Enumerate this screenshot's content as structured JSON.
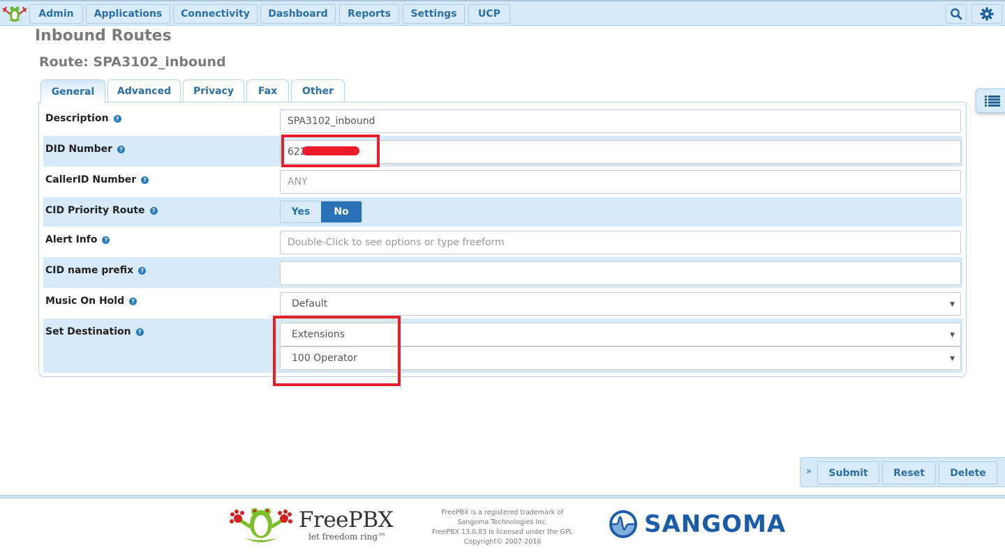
{
  "nav": {
    "items": [
      "Admin",
      "Applications",
      "Connectivity",
      "Dashboard",
      "Reports",
      "Settings",
      "UCP"
    ],
    "search_icon": "search-icon",
    "settings_icon": "gear-icon"
  },
  "page": {
    "title": "Inbound Routes",
    "route_title": "Route: SPA3102_inbound"
  },
  "tabs": [
    {
      "label": "General",
      "active": true
    },
    {
      "label": "Advanced",
      "active": false
    },
    {
      "label": "Privacy",
      "active": false
    },
    {
      "label": "Fax",
      "active": false
    },
    {
      "label": "Other",
      "active": false
    }
  ],
  "form": {
    "description": {
      "label": "Description",
      "value": "SPA3102_inbound"
    },
    "did_number": {
      "label": "DID Number",
      "value": "622",
      "redacted": true
    },
    "callerid_number": {
      "label": "CallerID Number",
      "placeholder": "ANY"
    },
    "cid_priority_route": {
      "label": "CID Priority Route",
      "options": [
        "Yes",
        "No"
      ],
      "selected": "No"
    },
    "alert_info": {
      "label": "Alert Info",
      "placeholder": "Double-Click to see options or type freeform"
    },
    "cid_name_prefix": {
      "label": "CID name prefix",
      "value": ""
    },
    "music_on_hold": {
      "label": "Music On Hold",
      "value": "Default"
    },
    "set_destination": {
      "label": "Set Destination",
      "type_value": "Extensions",
      "target_value": "100 Operator"
    }
  },
  "help_glyph": "?",
  "caret_glyph": "▼",
  "actions": {
    "expand_glyph": "»",
    "submit": "Submit",
    "reset": "Reset",
    "delete": "Delete"
  },
  "footer": {
    "brand": "FreePBX",
    "tagline": "let freedom ring™",
    "legal": [
      "FreePBX is a registered trademark of",
      "Sangoma Technologies Inc.",
      "FreePBX 13.0.83 is licensed under the GPL",
      "Copyright© 2007-2016"
    ],
    "partner": "SANGOMA"
  },
  "colors": {
    "accent": "#2a6fa8",
    "nav_bg": "#d6e9f8",
    "highlight_annotation": "#e8202a"
  }
}
